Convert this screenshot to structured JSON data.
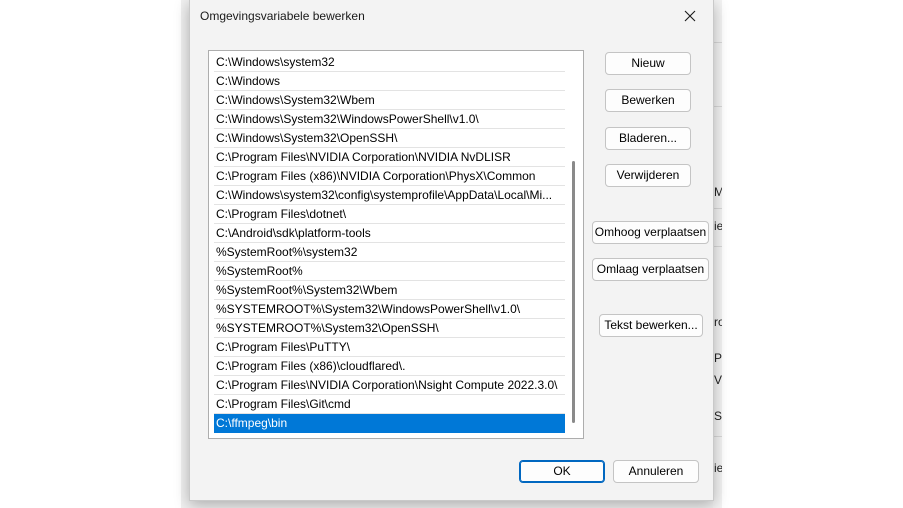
{
  "dialog": {
    "title": "Omgevingsvariabele bewerken",
    "close_icon": "close-icon"
  },
  "paths": [
    "C:\\Windows\\system32",
    "C:\\Windows",
    "C:\\Windows\\System32\\Wbem",
    "C:\\Windows\\System32\\WindowsPowerShell\\v1.0\\",
    "C:\\Windows\\System32\\OpenSSH\\",
    "C:\\Program Files\\NVIDIA Corporation\\NVIDIA NvDLISR",
    "C:\\Program Files (x86)\\NVIDIA Corporation\\PhysX\\Common",
    "C:\\Windows\\system32\\config\\systemprofile\\AppData\\Local\\Mi...",
    "C:\\Program Files\\dotnet\\",
    "C:\\Android\\sdk\\platform-tools",
    "%SystemRoot%\\system32",
    "%SystemRoot%",
    "%SystemRoot%\\System32\\Wbem",
    "%SYSTEMROOT%\\System32\\WindowsPowerShell\\v1.0\\",
    "%SYSTEMROOT%\\System32\\OpenSSH\\",
    "C:\\Program Files\\PuTTY\\",
    "C:\\Program Files (x86)\\cloudflared\\.",
    "C:\\Program Files\\NVIDIA Corporation\\Nsight Compute 2022.3.0\\",
    "C:\\Program Files\\Git\\cmd",
    "C:\\ffmpeg\\bin"
  ],
  "selected_index": 19,
  "buttons": {
    "new": "Nieuw",
    "edit": "Bewerken",
    "browse": "Bladeren...",
    "delete": "Verwijderen",
    "move_up": "Omhoog verplaatsen",
    "move_down": "Omlaag verplaatsen",
    "edit_text": "Tekst bewerken...",
    "ok": "OK",
    "cancel": "Annuleren"
  },
  "background_fragments": [
    "Mi",
    "ie",
    "ro",
    "PU",
    "V",
    "S",
    "ie"
  ],
  "colors": {
    "selection": "#0078d7",
    "primary_border": "#0067c0"
  }
}
